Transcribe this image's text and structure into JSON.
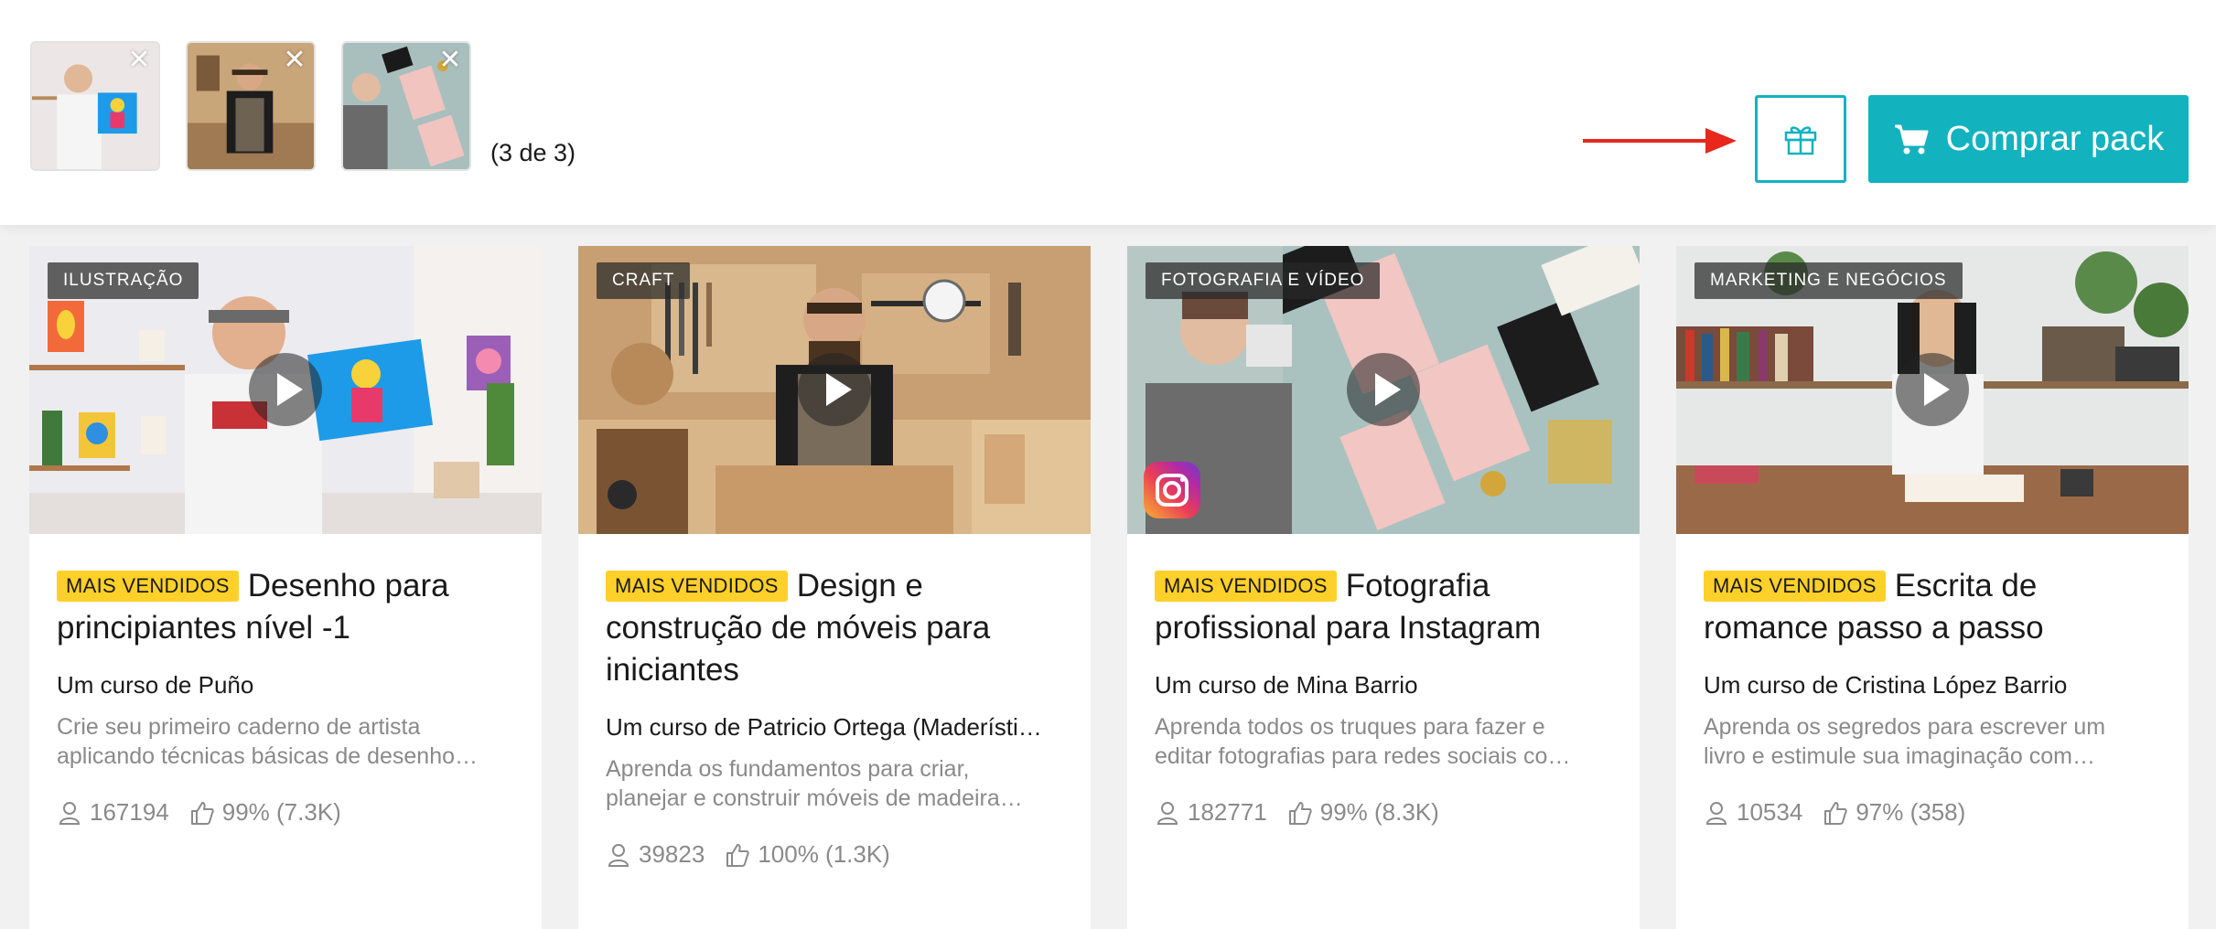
{
  "selection": {
    "thumbnails": [
      {
        "course": "Desenho para principiantes nível -1",
        "remove_icon": "close-icon"
      },
      {
        "course": "Design e construção de móveis para iniciantes",
        "remove_icon": "close-icon"
      },
      {
        "course": "Fotografia profissional para Instagram",
        "remove_icon": "close-icon"
      }
    ],
    "count_label": "(3 de 3)"
  },
  "actions": {
    "gift_icon": "gift-icon",
    "buy_label": "Comprar pack",
    "buy_icon": "cart-icon",
    "accent_color": "#13b2bf",
    "annotation_arrow_color": "#e8271d"
  },
  "cards": [
    {
      "category": "ILUSTRAÇÃO",
      "badge": "MAIS VENDIDOS",
      "title": "Desenho para principiantes nível -1",
      "author": "Um curso de Puño",
      "desc_line1": "Crie seu primeiro caderno de artista",
      "desc_line2": "aplicando técnicas básicas de desenho…",
      "students": "167194",
      "rating": "99% (7.3K)"
    },
    {
      "category": "CRAFT",
      "badge": "MAIS VENDIDOS",
      "title": "Design e construção de móveis para iniciantes",
      "author": "Um curso de Patricio Ortega (Maderísti…",
      "desc_line1": "Aprenda os fundamentos para criar,",
      "desc_line2": "planejar e construir móveis de madeira…",
      "students": "39823",
      "rating": "100% (1.3K)"
    },
    {
      "category": "FOTOGRAFIA E VÍDEO",
      "badge": "MAIS VENDIDOS",
      "title": "Fotografia profissional para Instagram",
      "author": "Um curso de Mina Barrio",
      "desc_line1": "Aprenda todos os truques para fazer e",
      "desc_line2": "editar fotografias para redes sociais co…",
      "students": "182771",
      "rating": "99% (8.3K)"
    },
    {
      "category": "MARKETING E NEGÓCIOS",
      "badge": "MAIS VENDIDOS",
      "title": "Escrita de romance passo a passo",
      "author": "Um curso de Cristina López Barrio",
      "desc_line1": "Aprenda os segredos para escrever um",
      "desc_line2": "livro e estimule sua imaginação com…",
      "students": "10534",
      "rating": "97% (358)"
    }
  ],
  "colors": {
    "badge": "#ffd029",
    "muted_text": "#8a8a8a"
  },
  "icons": {
    "students": "user-icon",
    "rating": "thumbs-up-icon",
    "play": "play-icon",
    "instagram": "instagram-icon"
  }
}
